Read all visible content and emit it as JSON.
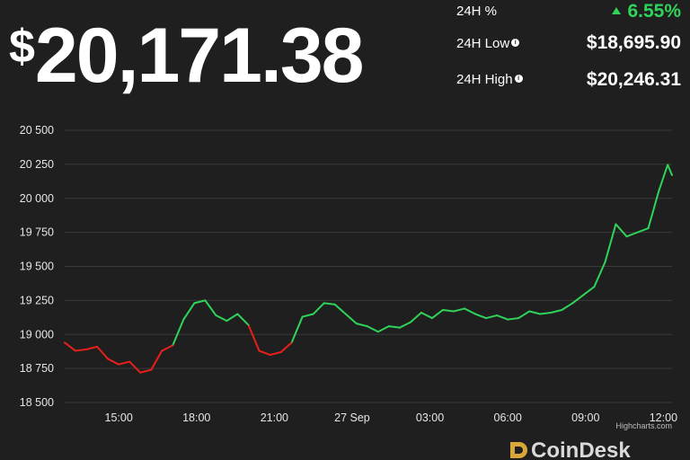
{
  "price": {
    "currency": "$",
    "value": "20,171.38"
  },
  "stats": [
    {
      "label": "24H %",
      "value": "6.55%",
      "trend": "up",
      "info": false
    },
    {
      "label": "24H Low",
      "value": "$18,695.90",
      "info": true
    },
    {
      "label": "24H High",
      "value": "$20,246.31",
      "info": true
    }
  ],
  "icons": {
    "info": "info-icon",
    "trend": "up-triangle-icon",
    "logo": "coindesk-logo-icon"
  },
  "colors": {
    "up": "#2fd35a",
    "down": "#e8201a",
    "background": "#1f1f1f",
    "grid": "#3a3a3a"
  },
  "credit": "Highcharts.com",
  "logo_text": "CoinDesk",
  "chart_data": {
    "type": "line",
    "xlabel": "",
    "ylabel": "",
    "ylim": [
      18500,
      20500
    ],
    "y_ticks": [
      20500,
      20250,
      20000,
      19750,
      19500,
      19250,
      19000,
      18750,
      18500
    ],
    "y_tick_labels": [
      "20 500",
      "20 250",
      "20 000",
      "19 750",
      "19 500",
      "19 250",
      "19 000",
      "18 750",
      "18 500"
    ],
    "x_range": [
      "26 Sep 12:55",
      "27 Sep 12:20"
    ],
    "x_ticks": [
      "26 Sep 15:00",
      "26 Sep 18:00",
      "26 Sep 21:00",
      "27 Sep 00:00",
      "27 Sep 03:00",
      "27 Sep 06:00",
      "27 Sep 09:00",
      "27 Sep 12:00"
    ],
    "x_tick_labels": [
      "15:00",
      "18:00",
      "21:00",
      "27 Sep",
      "03:00",
      "06:00",
      "09:00",
      "12:00"
    ],
    "grid": true,
    "legend": "none",
    "series": [
      {
        "color_rule": "green when above 19000, red when below 19000",
        "x": [
          "26 Sep 12:55",
          "26 Sep 13:20",
          "26 Sep 13:45",
          "26 Sep 14:10",
          "26 Sep 14:35",
          "26 Sep 15:00",
          "26 Sep 15:25",
          "26 Sep 15:50",
          "26 Sep 16:15",
          "26 Sep 16:40",
          "26 Sep 17:05",
          "26 Sep 17:30",
          "26 Sep 17:55",
          "26 Sep 18:20",
          "26 Sep 18:45",
          "26 Sep 19:10",
          "26 Sep 19:35",
          "26 Sep 20:00",
          "26 Sep 20:25",
          "26 Sep 20:50",
          "26 Sep 21:15",
          "26 Sep 21:40",
          "26 Sep 22:05",
          "26 Sep 22:30",
          "26 Sep 22:55",
          "26 Sep 23:20",
          "26 Sep 23:45",
          "27 Sep 00:10",
          "27 Sep 00:35",
          "27 Sep 01:00",
          "27 Sep 01:25",
          "27 Sep 01:50",
          "27 Sep 02:15",
          "27 Sep 02:40",
          "27 Sep 03:05",
          "27 Sep 03:30",
          "27 Sep 03:55",
          "27 Sep 04:20",
          "27 Sep 04:45",
          "27 Sep 05:10",
          "27 Sep 05:35",
          "27 Sep 06:00",
          "27 Sep 06:25",
          "27 Sep 06:50",
          "27 Sep 07:15",
          "27 Sep 07:40",
          "27 Sep 08:05",
          "27 Sep 08:30",
          "27 Sep 08:55",
          "27 Sep 09:20",
          "27 Sep 09:45",
          "27 Sep 10:10",
          "27 Sep 10:35",
          "27 Sep 11:00",
          "27 Sep 11:25",
          "27 Sep 11:50",
          "27 Sep 12:10",
          "27 Sep 12:20"
        ],
        "y": [
          18940,
          18880,
          18890,
          18910,
          18820,
          18780,
          18800,
          18720,
          18740,
          18880,
          18920,
          19110,
          19230,
          19250,
          19140,
          19100,
          19150,
          19070,
          18880,
          18850,
          18870,
          18940,
          19130,
          19150,
          19230,
          19220,
          19150,
          19080,
          19060,
          19020,
          19060,
          19050,
          19090,
          19160,
          19120,
          19180,
          19170,
          19190,
          19150,
          19120,
          19140,
          19110,
          19120,
          19170,
          19150,
          19160,
          19180,
          19230,
          19290,
          19350,
          19530,
          19810,
          19720,
          19750,
          19780,
          20060,
          20246,
          20171
        ]
      }
    ]
  }
}
